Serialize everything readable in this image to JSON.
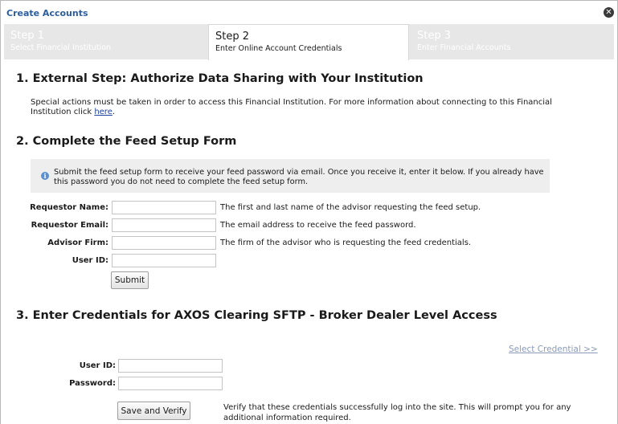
{
  "dialog": {
    "title": "Create Accounts"
  },
  "steps": [
    {
      "num": "Step 1",
      "sub": "Select Financial Institution"
    },
    {
      "num": "Step 2",
      "sub": "Enter Online Account Credentials"
    },
    {
      "num": "Step 3",
      "sub": "Enter Financial Accounts"
    }
  ],
  "section1": {
    "heading": "1. External Step: Authorize Data Sharing with Your Institution",
    "text": "Special actions must be taken in order to access this Financial Institution. For more information about connecting to this Financial Institution click ",
    "link": "here",
    "after_link": "."
  },
  "section2": {
    "heading": "2. Complete the Feed Setup Form",
    "info": "Submit the feed setup form to receive your feed password via email. Once you receive it, enter it below. If you already have this password you do not need to complete the feed setup form.",
    "fields": [
      {
        "label": "Requestor Name:",
        "value": "",
        "hint": "The first and last name of the advisor requesting the feed setup."
      },
      {
        "label": "Requestor Email:",
        "value": "",
        "hint": "The email address to receive the feed password."
      },
      {
        "label": "Advisor Firm:",
        "value": "",
        "hint": "The firm of the advisor who is requesting the feed credentials."
      },
      {
        "label": "User ID:",
        "value": "",
        "hint": ""
      }
    ],
    "submit_label": "Submit"
  },
  "section3": {
    "heading": "3. Enter Credentials for AXOS Clearing SFTP - Broker Dealer Level Access",
    "select_credential": "Select Credential >>",
    "user_id_label": "User ID:",
    "user_id_value": "",
    "password_label": "Password:",
    "password_value": "",
    "save_label": "Save and Verify",
    "verify_text": "Verify that these credentials successfully log into the site. This will prompt you for any additional information required."
  },
  "colors": {
    "title": "#2c5e9e",
    "link": "#1b3fa0",
    "select_credential": "#8a9ab8",
    "info_icon": "#5b8fd0"
  },
  "icons": {
    "close": "close-icon",
    "info": "info-icon"
  }
}
